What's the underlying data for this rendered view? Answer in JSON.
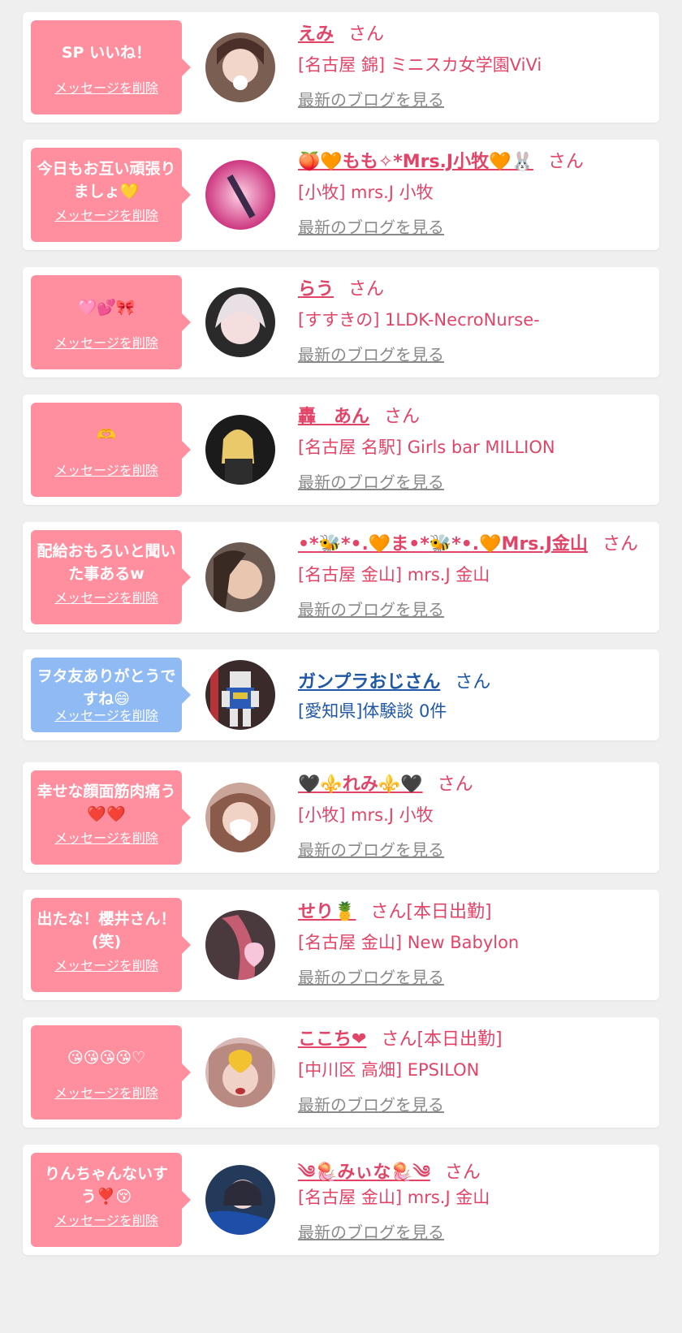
{
  "colors": {
    "card_bg": "#ffffff",
    "page_bg": "#efefef",
    "bubble_pink": "#ff8f9f",
    "bubble_blue": "#8fbaf4",
    "accent_pink": "#e24468",
    "accent_blue": "#1f58a6",
    "link_gray": "#8a8a8a"
  },
  "messages": [
    {
      "bubble_text": "SP いいね！",
      "delete_label": "メッセージを削除",
      "name": "えみ",
      "suffix": "さん",
      "shop": "[名古屋 錦] ミニスカ女学園ViVi",
      "blog_link": "最新のブログを見る",
      "theme": "pink"
    },
    {
      "bubble_text": "今日もお互い頑張りましょ💛",
      "delete_label": "メッセージを削除",
      "name": "🍑🧡もも✧*Mrs.J小牧🧡🐰",
      "suffix": "さん",
      "shop": "[小牧] mrs.J 小牧",
      "blog_link": "最新のブログを見る",
      "theme": "pink"
    },
    {
      "bubble_text": "🩷💕🎀",
      "delete_label": "メッセージを削除",
      "name": "らう",
      "suffix": "さん",
      "shop": "[すすきの] 1LDK-NecroNurse-",
      "blog_link": "最新のブログを見る",
      "theme": "pink"
    },
    {
      "bubble_text": "🫶",
      "delete_label": "メッセージを削除",
      "name": "轟　あん",
      "suffix": "さん",
      "shop": "[名古屋 名駅] Girls bar MILLION",
      "blog_link": "最新のブログを見る",
      "theme": "pink"
    },
    {
      "bubble_text": "配給おもろいと聞いた事あるw",
      "delete_label": "メッセージを削除",
      "name": "•*🐝*•.🧡ま•*🐝*•.🧡Mrs.J金山",
      "suffix": "さん",
      "shop": "[名古屋 金山] mrs.J 金山",
      "blog_link": "最新のブログを見る",
      "theme": "pink"
    },
    {
      "bubble_text": "ヲタ友ありがとうですね😄",
      "delete_label": "メッセージを削除",
      "name": "ガンプラおじさん",
      "suffix": "さん",
      "shop": "[愛知県]体験談 0件",
      "blog_link": "",
      "theme": "blue"
    },
    {
      "bubble_text": "幸せな顔面筋肉痛う❤️❤️",
      "delete_label": "メッセージを削除",
      "name": "🖤⚜️れみ⚜️🖤",
      "suffix": "さん",
      "shop": "[小牧] mrs.J 小牧",
      "blog_link": "最新のブログを見る",
      "theme": "pink"
    },
    {
      "bubble_text": "出たな！櫻井さん！(笑)",
      "delete_label": "メッセージを削除",
      "name": "せり🍍",
      "suffix": "さん[本日出勤]",
      "shop": "[名古屋 金山] New Babylon",
      "blog_link": "最新のブログを見る",
      "theme": "pink"
    },
    {
      "bubble_text": "😘😘😘😘♡",
      "delete_label": "メッセージを削除",
      "name": "ここち❤",
      "suffix": "さん[本日出勤]",
      "shop": "[中川区 高畑] EPSILON",
      "blog_link": "最新のブログを見る",
      "theme": "pink"
    },
    {
      "bubble_text": "りんちゃんないすう❣️😚",
      "delete_label": "メッセージを削除",
      "name": "༄🪼みぃな🪼༄",
      "suffix": "さん",
      "shop": "[名古屋 金山] mrs.J 金山",
      "blog_link": "最新のブログを見る",
      "theme": "pink"
    }
  ]
}
